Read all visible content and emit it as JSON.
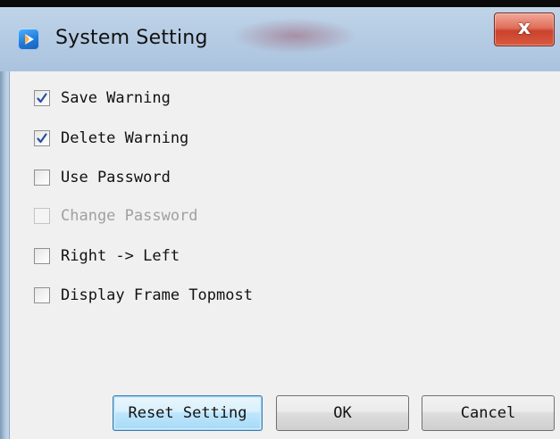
{
  "window": {
    "title": "System Setting",
    "close_glyph": "x",
    "app_icon": "app-logo-icon"
  },
  "options": [
    {
      "label": "Save Warning",
      "checked": true,
      "enabled": true
    },
    {
      "label": "Delete Warning",
      "checked": true,
      "enabled": true
    },
    {
      "label": "Use Password",
      "checked": false,
      "enabled": true
    },
    {
      "label": "Change Password",
      "checked": false,
      "enabled": false
    },
    {
      "label": "Right -> Left",
      "checked": false,
      "enabled": true
    },
    {
      "label": "Display Frame Topmost",
      "checked": false,
      "enabled": true
    }
  ],
  "buttons": {
    "reset_label": "Reset Setting",
    "ok_label": "OK",
    "cancel_label": "Cancel"
  },
  "colors": {
    "title_bar": "#b7cde4",
    "close_button": "#d95a3f",
    "check_mark": "#2a4f9e",
    "focus_border": "#3c7fb1"
  }
}
